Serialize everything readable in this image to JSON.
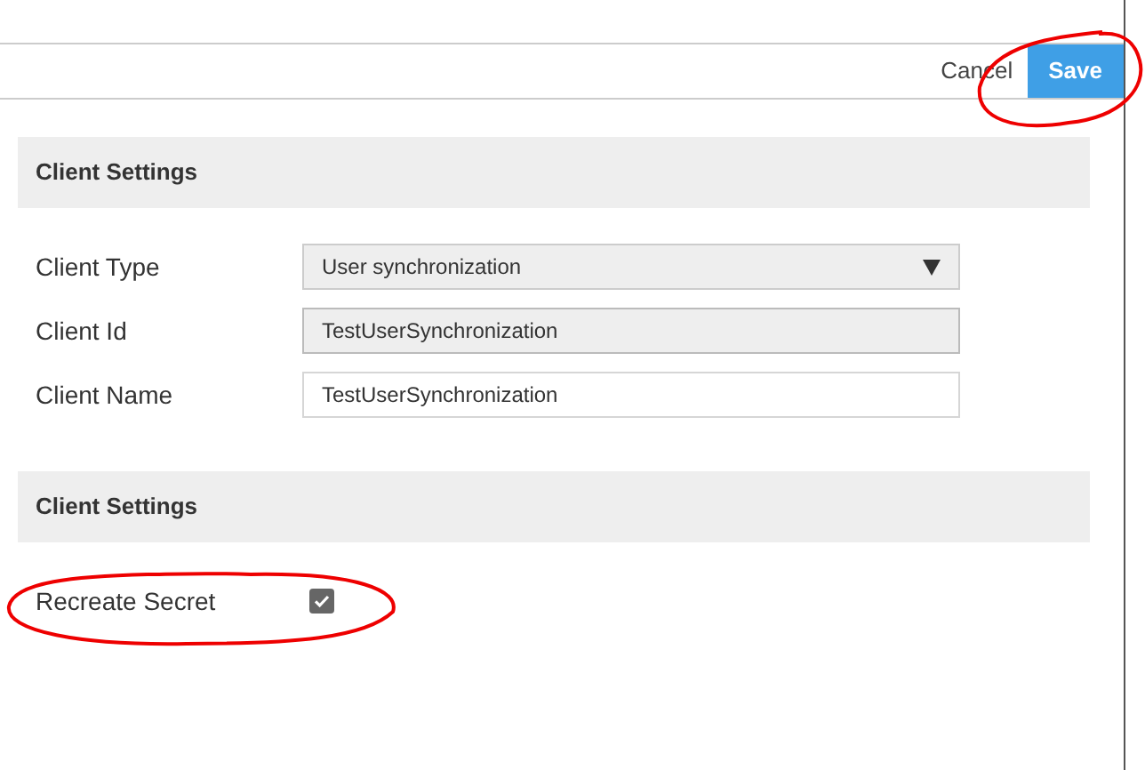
{
  "toolbar": {
    "buttons": [
      {
        "label": "Cancel",
        "kind": "link"
      },
      {
        "label": "Save",
        "kind": "primary"
      }
    ]
  },
  "sections": [
    {
      "title": "Client Settings",
      "fields": [
        {
          "label": "Client Type",
          "kind": "select",
          "value": "User synchronization"
        },
        {
          "label": "Client Id",
          "kind": "text",
          "value": "TestUserSynchronization",
          "readonly": true
        },
        {
          "label": "Client Name",
          "kind": "text",
          "value": "TestUserSynchronization",
          "readonly": false
        }
      ]
    },
    {
      "title": "Client Settings",
      "fields": [
        {
          "label": "Recreate Secret",
          "kind": "checkbox",
          "checked": true
        }
      ]
    }
  ]
}
